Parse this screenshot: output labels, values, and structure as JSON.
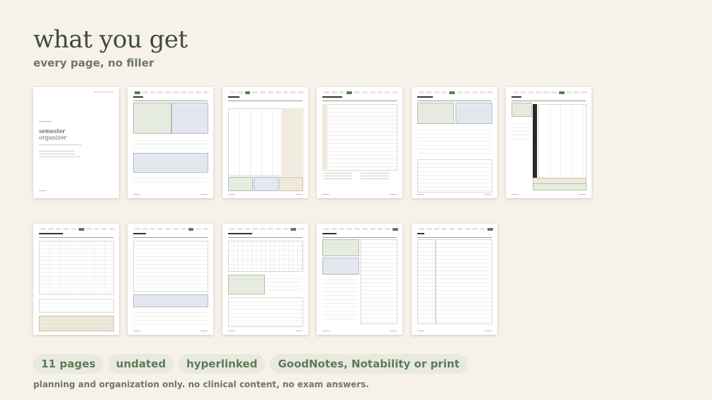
{
  "header": {
    "title": "what you get",
    "subtitle": "every page, no filler"
  },
  "pages": [
    {
      "id": "cover",
      "title": "semester",
      "subtitle": "organizer"
    },
    {
      "id": "start-here"
    },
    {
      "id": "the-month"
    },
    {
      "id": "semester-at-a-glance"
    },
    {
      "id": "class-dashboard"
    },
    {
      "id": "the-week"
    },
    {
      "id": "clinical-lab-tracker"
    },
    {
      "id": "grade-tracker"
    },
    {
      "id": "habits-tracker"
    },
    {
      "id": "sunday-reset"
    },
    {
      "id": "notes"
    }
  ],
  "badges": [
    "11 pages",
    "undated",
    "hyperlinked",
    "GoodNotes, Notability or print"
  ],
  "footer_note": "planning and organization only. no clinical content, no exam answers."
}
